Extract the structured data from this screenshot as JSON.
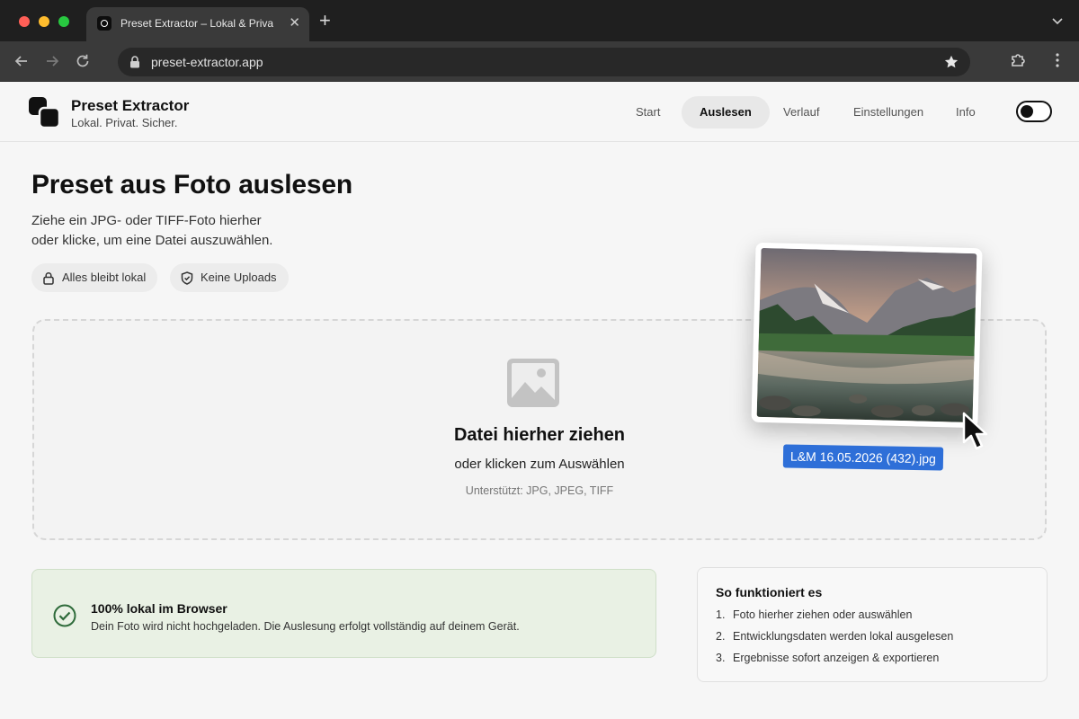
{
  "browser": {
    "tab_title": "Preset Extractor – Lokal & Privat",
    "url": "preset-extractor.app"
  },
  "app": {
    "brand_name": "Preset Extractor",
    "tagline": "Lokal. Privat. Sicher.",
    "nav": [
      {
        "label": "Start",
        "active": false
      },
      {
        "label": "Auslesen",
        "active": true
      },
      {
        "label": "Verlauf",
        "active": false
      },
      {
        "label": "Einstellungen",
        "active": false
      },
      {
        "label": "Info",
        "active": false
      }
    ],
    "theme_toggle": "dark-mode-toggle"
  },
  "main": {
    "title": "Preset aus Foto auslesen",
    "subtitle_line1": "Ziehe ein JPG- oder TIFF-Foto hierher",
    "subtitle_line2": "oder klicke, um eine Datei auszuwählen.",
    "chips": [
      {
        "label": "Alles bleibt lokal",
        "icon": "lock-icon"
      },
      {
        "label": "Keine Uploads",
        "icon": "shield-icon"
      }
    ],
    "dropzone": {
      "title": "Datei hierher ziehen",
      "subtitle": "oder klicken zum Auswählen",
      "hint": "Unterstützt: JPG, JPEG, TIFF",
      "icon": "image-icon"
    },
    "dragged_file": {
      "name": "L&M 16.05.2026 (432).jpg"
    }
  },
  "info": {
    "title": "100% lokal im Browser",
    "text": "Dein Foto wird nicht hochgeladen. Die Auslesung erfolgt vollständig auf deinem Gerät."
  },
  "how": {
    "title": "So funktioniert es",
    "steps": [
      {
        "num": "1.",
        "text": "Foto hierher ziehen oder auswählen"
      },
      {
        "num": "2.",
        "text": "Entwicklungsdaten werden lokal ausgelesen"
      },
      {
        "num": "3.",
        "text": "Ergebnisse sofort anzeigen & exportieren"
      }
    ]
  },
  "colors": {
    "accent_blue": "#2e6fd8",
    "success_green": "#2e6b3a",
    "success_bg": "#e9f1e4"
  }
}
